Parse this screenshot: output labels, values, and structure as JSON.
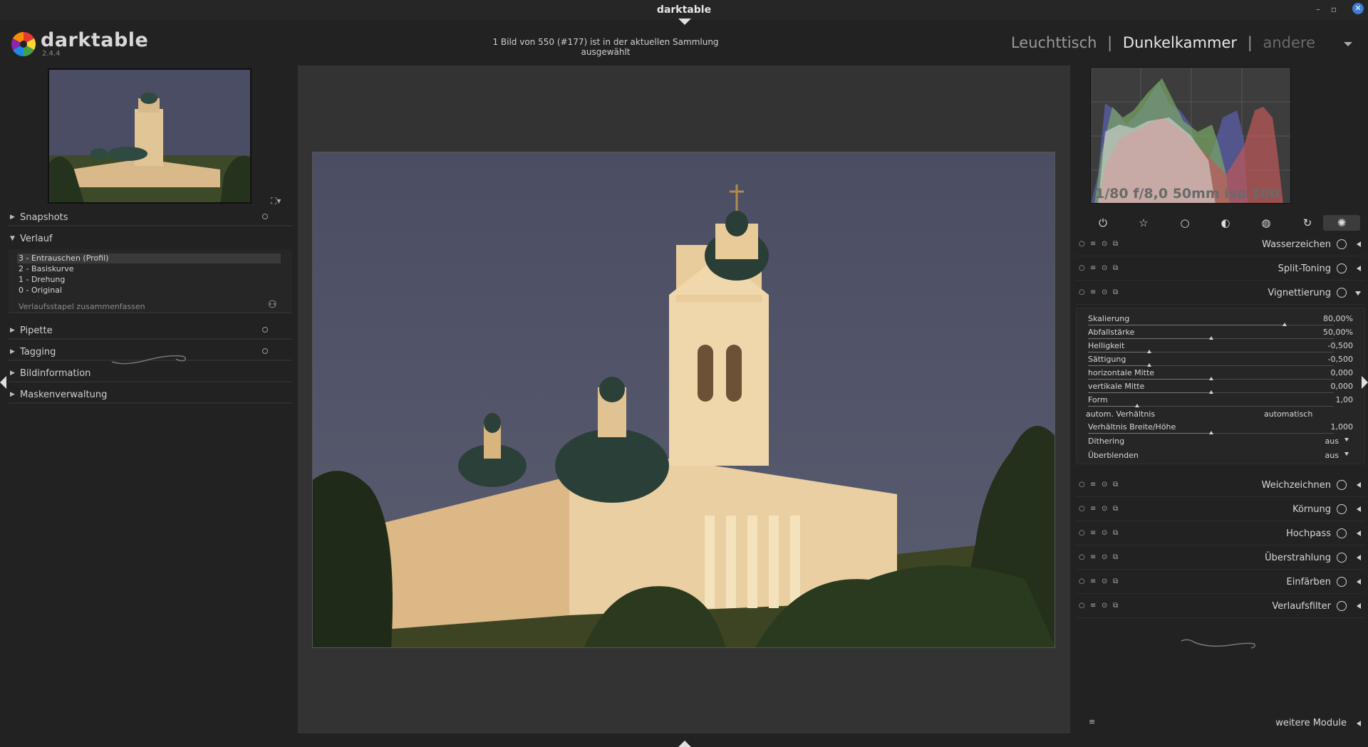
{
  "window": {
    "title": "darktable"
  },
  "app": {
    "name": "darktable",
    "version": "2.4.4"
  },
  "header": {
    "selection_info": "1 Bild von 550 (#177) ist in der aktuellen Sammlung ausgewählt",
    "views": {
      "lighttable": "Leuchttisch",
      "darkroom": "Dunkelkammer",
      "other": "andere",
      "separator": "|"
    }
  },
  "left_panel": {
    "sections": {
      "snapshots": "Snapshots",
      "history": "Verlauf",
      "color_picker": "Pipette",
      "tagging": "Tagging",
      "image_info": "Bildinformation",
      "mask_manager": "Maskenverwaltung"
    },
    "history_items": [
      "3 - Entrauschen (Profil)",
      "2 - Basiskurve",
      "1 - Drehung",
      "0 - Original"
    ],
    "history_compress": "Verlaufsstapel zusammenfassen"
  },
  "right_panel": {
    "exif": "1/80 f/8,0 50mm iso 100",
    "modules": {
      "watermark": "Wasserzeichen",
      "split_toning": "Split-Toning",
      "vignette": "Vignettierung",
      "blur": "Weichzeichnen",
      "grain": "Körnung",
      "highpass": "Hochpass",
      "bloom": "Überstrahlung",
      "colorize": "Einfärben",
      "graduated": "Verlaufsfilter"
    },
    "vignette_params": {
      "scale": {
        "label": "Skalierung",
        "value": "80,00%",
        "fraction": 0.8
      },
      "falloff": {
        "label": "Abfallstärke",
        "value": "50,00%",
        "fraction": 0.5
      },
      "brightness": {
        "label": "Helligkeit",
        "value": "-0,500",
        "fraction": 0.25
      },
      "saturation": {
        "label": "Sättigung",
        "value": "-0,500",
        "fraction": 0.25
      },
      "h_center": {
        "label": "horizontale Mitte",
        "value": "0,000",
        "fraction": 0.5
      },
      "v_center": {
        "label": "vertikale Mitte",
        "value": "0,000",
        "fraction": 0.5
      },
      "shape": {
        "label": "Form",
        "value": "1,00",
        "fraction": 0.2
      },
      "auto_ratio": {
        "label": "autom. Verhältnis",
        "value": "automatisch"
      },
      "ratio": {
        "label": "Verhältnis Breite/Höhe",
        "value": "1,000",
        "fraction": 0.5
      },
      "dithering": {
        "label": "Dithering",
        "value": "aus"
      },
      "blend": {
        "label": "Überblenden",
        "value": "aus"
      }
    },
    "more_modules": "weitere Module"
  }
}
